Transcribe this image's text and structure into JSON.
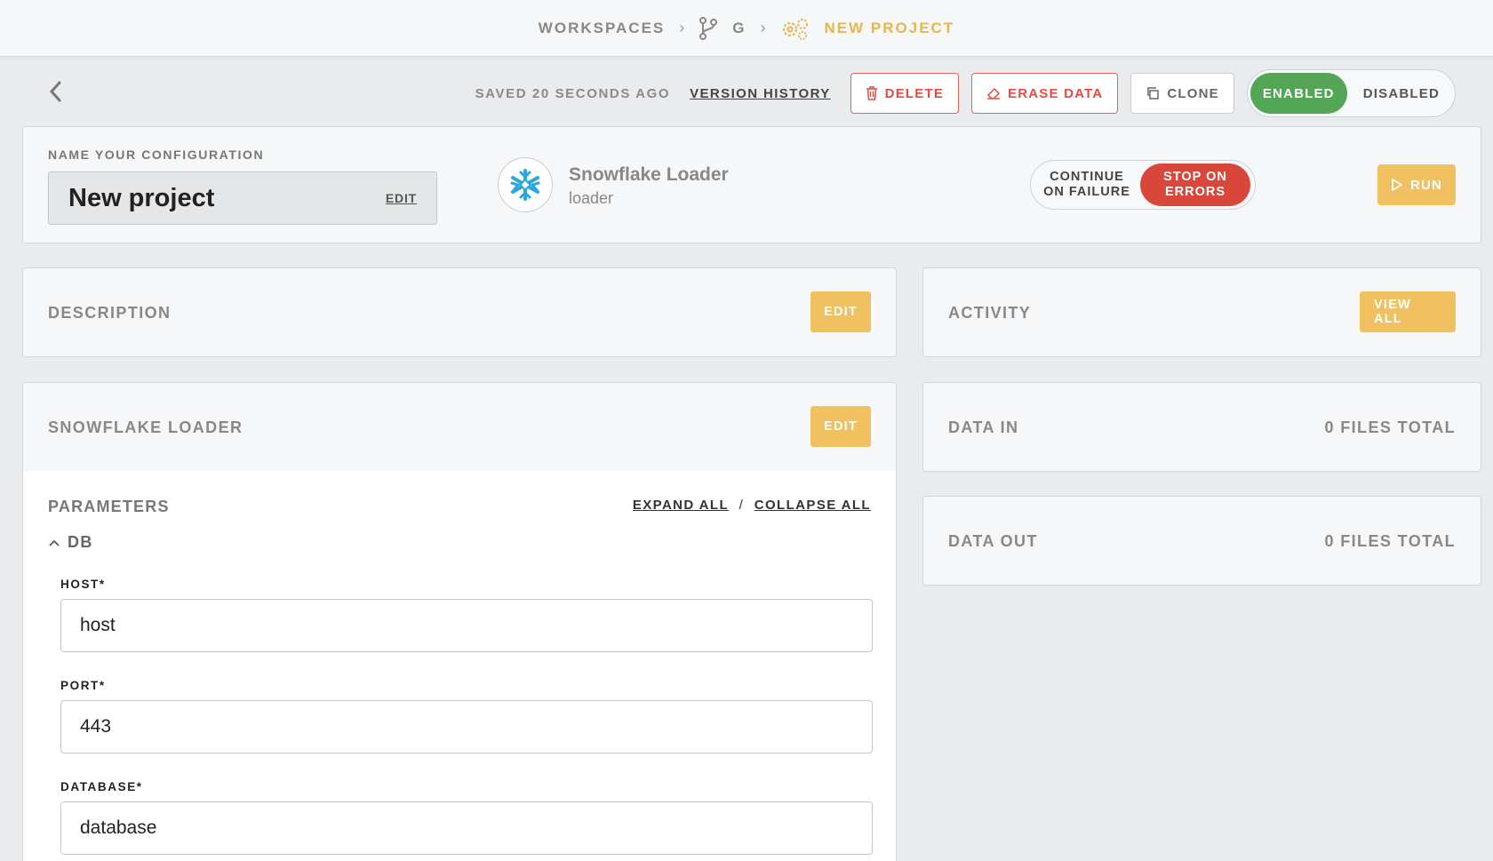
{
  "breadcrumb": {
    "workspaces": "WORKSPACES",
    "branch": "G",
    "project": "NEW PROJECT"
  },
  "toolbar": {
    "saved": "SAVED 20 SECONDS AGO",
    "version_history": "VERSION HISTORY",
    "delete": "DELETE",
    "erase": "ERASE DATA",
    "clone": "CLONE",
    "enabled": "ENABLED",
    "disabled": "DISABLED"
  },
  "config": {
    "label": "NAME YOUR CONFIGURATION",
    "name": "New project",
    "edit": "EDIT",
    "loader_title": "Snowflake Loader",
    "loader_sub": "loader",
    "continue_line1": "CONTINUE",
    "continue_line2": "ON FAILURE",
    "stop_line1": "STOP ON",
    "stop_line2": "ERRORS",
    "run": "RUN"
  },
  "description": {
    "title": "DESCRIPTION",
    "edit": "EDIT"
  },
  "activity": {
    "title": "ACTIVITY",
    "view_all": "VIEW ALL"
  },
  "snowflake_section": {
    "title": "SNOWFLAKE LOADER",
    "edit": "EDIT"
  },
  "data_in": {
    "title": "DATA IN",
    "value": "0 FILES TOTAL"
  },
  "data_out": {
    "title": "DATA OUT",
    "value": "0 FILES TOTAL"
  },
  "parameters": {
    "title": "PARAMETERS",
    "expand_all": "EXPAND ALL",
    "slash": "/",
    "collapse_all": "COLLAPSE ALL",
    "group": "DB",
    "fields": [
      {
        "label": "HOST*",
        "value": "host"
      },
      {
        "label": "PORT*",
        "value": "443"
      },
      {
        "label": "DATABASE*",
        "value": "database"
      }
    ]
  },
  "colors": {
    "accent_yellow": "#f0c061",
    "enabled_green": "#53a655",
    "stop_red": "#d9473b",
    "danger_red": "#e04d40"
  }
}
